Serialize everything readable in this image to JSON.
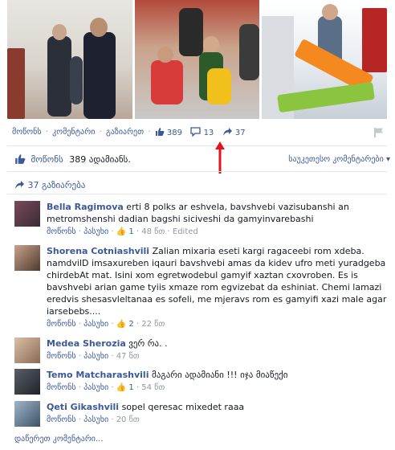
{
  "post": {
    "actions": {
      "like_label": "მოწონს",
      "comment_label": "კომენტარი",
      "share_label": "გაზიარეთ",
      "like_count": "389",
      "comment_count": "13",
      "share_count": "37"
    },
    "likes_summary": {
      "label": "მოწონს",
      "text": "389 ადამიანს."
    },
    "popular_comments": "საუკეთესო კომენტარები",
    "shares_text": "37 გაზიარება",
    "view_more": "დაწერეთ კომენტარი..."
  },
  "comments": [
    {
      "name": "Bella Ragimova",
      "text": "erti 8 polks ar eshvela, bavshvebi vazisubanshi an metromshenshi dadian bagshi siciveshi da gamyinvarebashi",
      "like_label": "მოწონს",
      "reply_label": "პასუხი",
      "like_count": "1",
      "time": "48 წთ",
      "edited": "Edited"
    },
    {
      "name": "Shorena Cotniashvili",
      "text": "Zalian mixaria eseti kargi ragaceebi rom xdeba. namdvilD imsaxureben iqauri bavshvebi amas da kidev ufro meti yuradgeba chirdebAt mat. Isini xom egretwodebul gamyif xaztan cxovroben. Es is bavshvebi arian game tyiis xmaze rom egvizebat da eshiniat. Chemi lamazi eredvis shesasvleltanaa es sofeli, me mjeravs rom es gamyifi xazi male agar iarsebebs....",
      "like_label": "მოწონს",
      "reply_label": "პასუხი",
      "like_count": "2",
      "time": "22 წთ"
    },
    {
      "name": "Medea Sherozia",
      "text": "ვერ რა. .",
      "like_label": "მოწონს",
      "reply_label": "პასუხი",
      "time": "47 წთ"
    },
    {
      "name": "Temo Matcharashvili",
      "text": "მაგარი ადამიანი !!! იჯა მიაწექი",
      "like_label": "მოწონს",
      "reply_label": "პასუხი",
      "like_count": "1",
      "time": "54 წთ"
    },
    {
      "name": "Qeti Gikashvili",
      "text": "sopel qeresac mixedet raaa",
      "like_label": "მოწონს",
      "reply_label": "პასუხი",
      "time": "20 წთ"
    }
  ],
  "colors": {
    "link": "#3b5998",
    "meta": "#9197a3",
    "annotation_arrow": "#e0141e"
  }
}
